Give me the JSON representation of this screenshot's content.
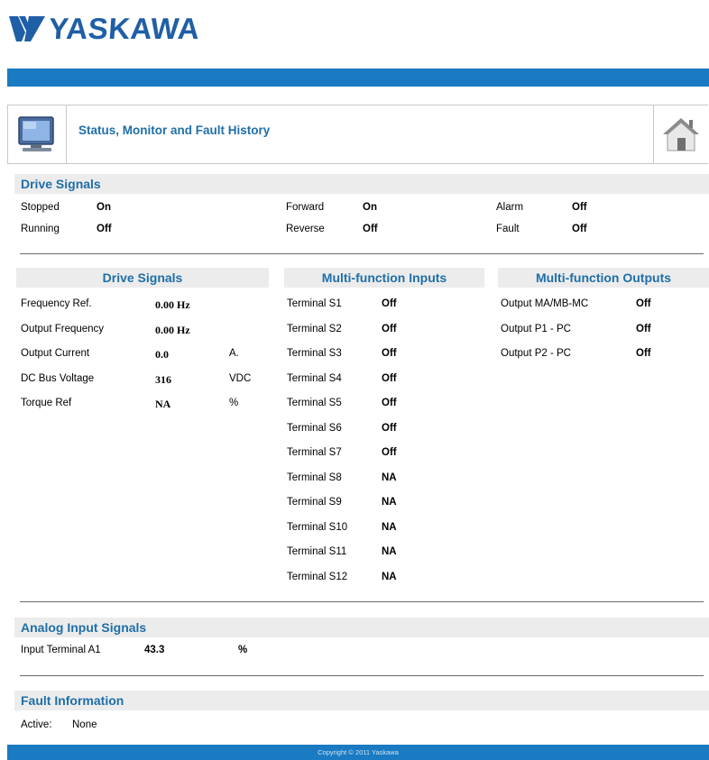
{
  "brand": {
    "name": "YASKAWA",
    "color": "#1f5fa6"
  },
  "header": {
    "title": "Status, Monitor and Fault History",
    "left_icon": "monitor-icon",
    "right_icon": "home-icon"
  },
  "drive_signals_top": {
    "title": "Drive Signals",
    "items": [
      {
        "label": "Stopped",
        "value": "On"
      },
      {
        "label": "Running",
        "value": "Off"
      },
      {
        "label": "Forward",
        "value": "On"
      },
      {
        "label": "Reverse",
        "value": "Off"
      },
      {
        "label": "Alarm",
        "value": "Off"
      },
      {
        "label": "Fault",
        "value": "Off"
      }
    ]
  },
  "drive_signals": {
    "title": "Drive Signals",
    "rows": [
      {
        "label": "Frequency Ref.",
        "value": "0.00 Hz",
        "unit": ""
      },
      {
        "label": "Output Frequency",
        "value": "0.00 Hz",
        "unit": ""
      },
      {
        "label": "Output Current",
        "value": "0.0",
        "unit": "A."
      },
      {
        "label": "DC Bus Voltage",
        "value": "316",
        "unit": "VDC"
      },
      {
        "label": "Torque Ref",
        "value": "NA",
        "unit": "%"
      }
    ]
  },
  "multi_inputs": {
    "title": "Multi-function Inputs",
    "rows": [
      {
        "label": "Terminal S1",
        "value": "Off"
      },
      {
        "label": "Terminal S2",
        "value": "Off"
      },
      {
        "label": "Terminal S3",
        "value": "Off"
      },
      {
        "label": "Terminal S4",
        "value": "Off"
      },
      {
        "label": "Terminal S5",
        "value": "Off"
      },
      {
        "label": "Terminal S6",
        "value": "Off"
      },
      {
        "label": "Terminal S7",
        "value": "Off"
      },
      {
        "label": "Terminal S8",
        "value": "NA"
      },
      {
        "label": "Terminal S9",
        "value": "NA"
      },
      {
        "label": "Terminal S10",
        "value": "NA"
      },
      {
        "label": "Terminal S11",
        "value": "NA"
      },
      {
        "label": "Terminal S12",
        "value": "NA"
      }
    ]
  },
  "multi_outputs": {
    "title": "Multi-function Outputs",
    "rows": [
      {
        "label": "Output MA/MB-MC",
        "value": "Off"
      },
      {
        "label": "Output P1 - PC",
        "value": "Off"
      },
      {
        "label": "Output P2 - PC",
        "value": "Off"
      }
    ]
  },
  "analog": {
    "title": "Analog Input Signals",
    "rows": [
      {
        "label": "Input Terminal A1",
        "value": "43.3",
        "unit": "%"
      }
    ]
  },
  "fault": {
    "title": "Fault Information",
    "active_label": "Active:",
    "active_value": "None"
  },
  "footer": {
    "text": "Copyright © 2011 Yaskawa"
  },
  "colors": {
    "accent_bar": "#1a7ac2",
    "section_title": "#1f6fa8",
    "section_band": "#ececec"
  }
}
